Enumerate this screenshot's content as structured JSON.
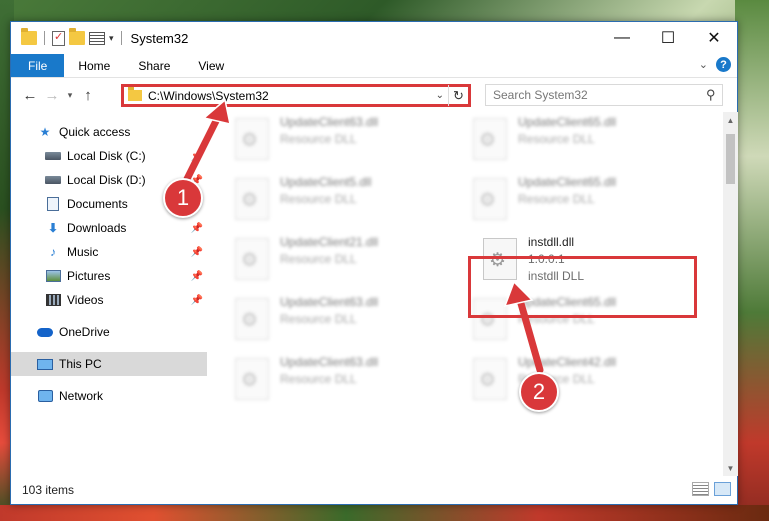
{
  "window": {
    "title": "System32"
  },
  "window_controls": {
    "minimize": "—",
    "maximize": "☐",
    "close": "✕"
  },
  "ribbon": {
    "tabs": [
      {
        "label": "File",
        "icon": ""
      },
      {
        "label": "Home",
        "icon": ""
      },
      {
        "label": "Share",
        "icon": ""
      },
      {
        "label": "View",
        "icon": ""
      }
    ],
    "help": "?"
  },
  "address": {
    "path": "C:\\Windows\\System32"
  },
  "search": {
    "placeholder": "Search System32"
  },
  "nav": {
    "quick_access": "Quick access",
    "items": [
      {
        "label": "Local Disk (C:)",
        "icon": "drive-icon",
        "pinned": true
      },
      {
        "label": "Local Disk (D:)",
        "icon": "drive-icon",
        "pinned": true
      },
      {
        "label": "Documents",
        "icon": "documents-icon",
        "pinned": true
      },
      {
        "label": "Downloads",
        "icon": "downloads-icon",
        "pinned": true
      },
      {
        "label": "Music",
        "icon": "music-icon",
        "pinned": true
      },
      {
        "label": "Pictures",
        "icon": "pictures-icon",
        "pinned": true
      },
      {
        "label": "Videos",
        "icon": "videos-icon",
        "pinned": true
      }
    ],
    "onedrive": "OneDrive",
    "this_pc": "This PC",
    "network": "Network"
  },
  "files": [
    {
      "name": "UpdateClient63.dll",
      "type": "Resource DLL"
    },
    {
      "name": "UpdateClient65.dll",
      "type": "Resource DLL"
    },
    {
      "name": "UpdateClient5.dll",
      "type": "Resource DLL"
    },
    {
      "name": "UpdateClient65.dll",
      "type": "Resource DLL"
    },
    {
      "name": "UpdateClient21.dll",
      "type": "Resource DLL"
    },
    {
      "name": "UpdateClient63.dll",
      "type": "Resource DLL"
    },
    {
      "name": "UpdateClient65.dll",
      "type": "Resource DLL"
    },
    {
      "name": "UpdateClient63.dll",
      "type": "Resource DLL"
    },
    {
      "name": "UpdateClient42.dll",
      "type": "Resource DLL"
    }
  ],
  "highlighted_file": {
    "name": "instdll.dll",
    "version": "1.0.0.1",
    "type": "instdll DLL"
  },
  "status": {
    "item_count": "103 items"
  },
  "callouts": {
    "one": "1",
    "two": "2",
    "color": "#d9383a"
  }
}
